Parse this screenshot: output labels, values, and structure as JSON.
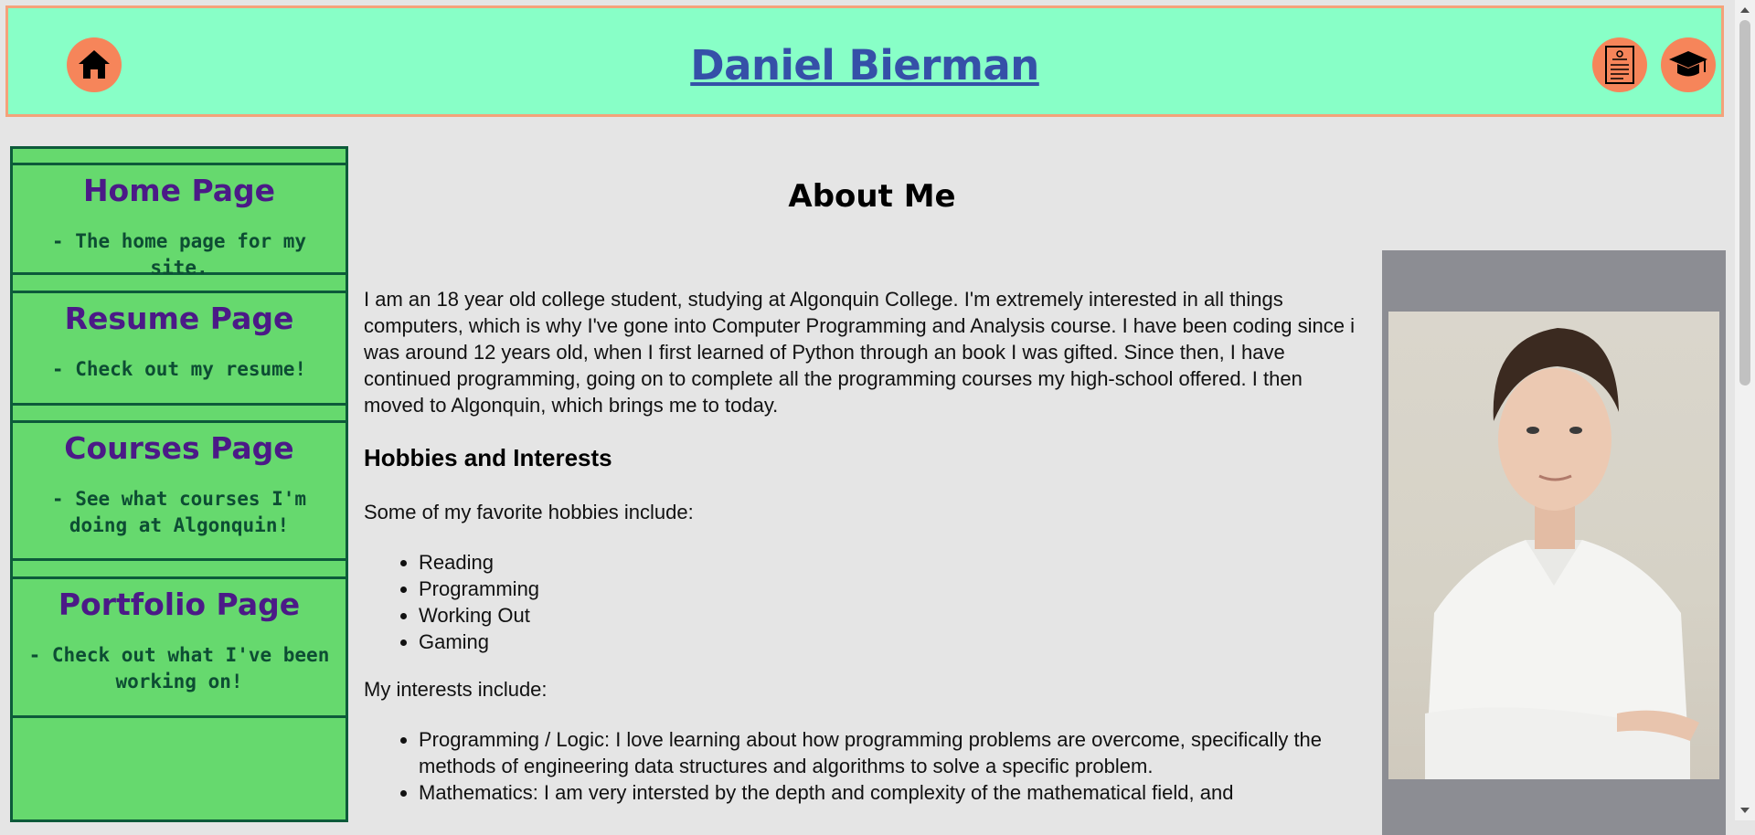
{
  "header": {
    "title": "Daniel Bierman",
    "home_icon": "home-icon",
    "resume_icon": "resume-document-icon",
    "courses_icon": "graduation-cap-icon"
  },
  "sidebar": {
    "items": [
      {
        "title": "Home Page",
        "desc": "- The home page for my site."
      },
      {
        "title": "Resume Page",
        "desc": "- Check out my resume!"
      },
      {
        "title": "Courses Page",
        "desc": "- See what courses I'm doing at Algonquin!"
      },
      {
        "title": "Portfolio Page",
        "desc": "- Check out what I've been working on!"
      }
    ]
  },
  "main": {
    "heading": "About Me",
    "intro": "I am an 18 year old college student, studying at Algonquin College. I'm extremely interested in all things computers, which is why I've gone into Computer Programming and Analysis course. I have been coding since i was around 12 years old, when I first learned of Python through an book I was gifted. Since then, I have continued programming, going on to complete all the programming courses my high-school offered. I then moved to Algonquin, which brings me to today.",
    "hobbies_heading": "Hobbies and Interests",
    "hobbies_intro": "Some of my favorite hobbies include:",
    "hobbies": [
      "Reading",
      "Programming",
      "Working Out",
      "Gaming"
    ],
    "interests_intro": "My interests include:",
    "interests": [
      "Programming / Logic: I love learning about how programming problems are overcome, specifically the methods of engineering data structures and algorithms to solve a specific problem.",
      "Mathematics: I am very intersted by the depth and complexity of the mathematical field, and"
    ]
  },
  "colors": {
    "header_bg": "#88ffc7",
    "header_border": "#f4a27a",
    "icon_bg": "#f6855a",
    "title_color": "#3550a8",
    "sidebar_bg": "#66d96e",
    "sidebar_border": "#0d5a3a",
    "nav_title": "#4b1a87",
    "page_bg": "#e5e5e5"
  }
}
